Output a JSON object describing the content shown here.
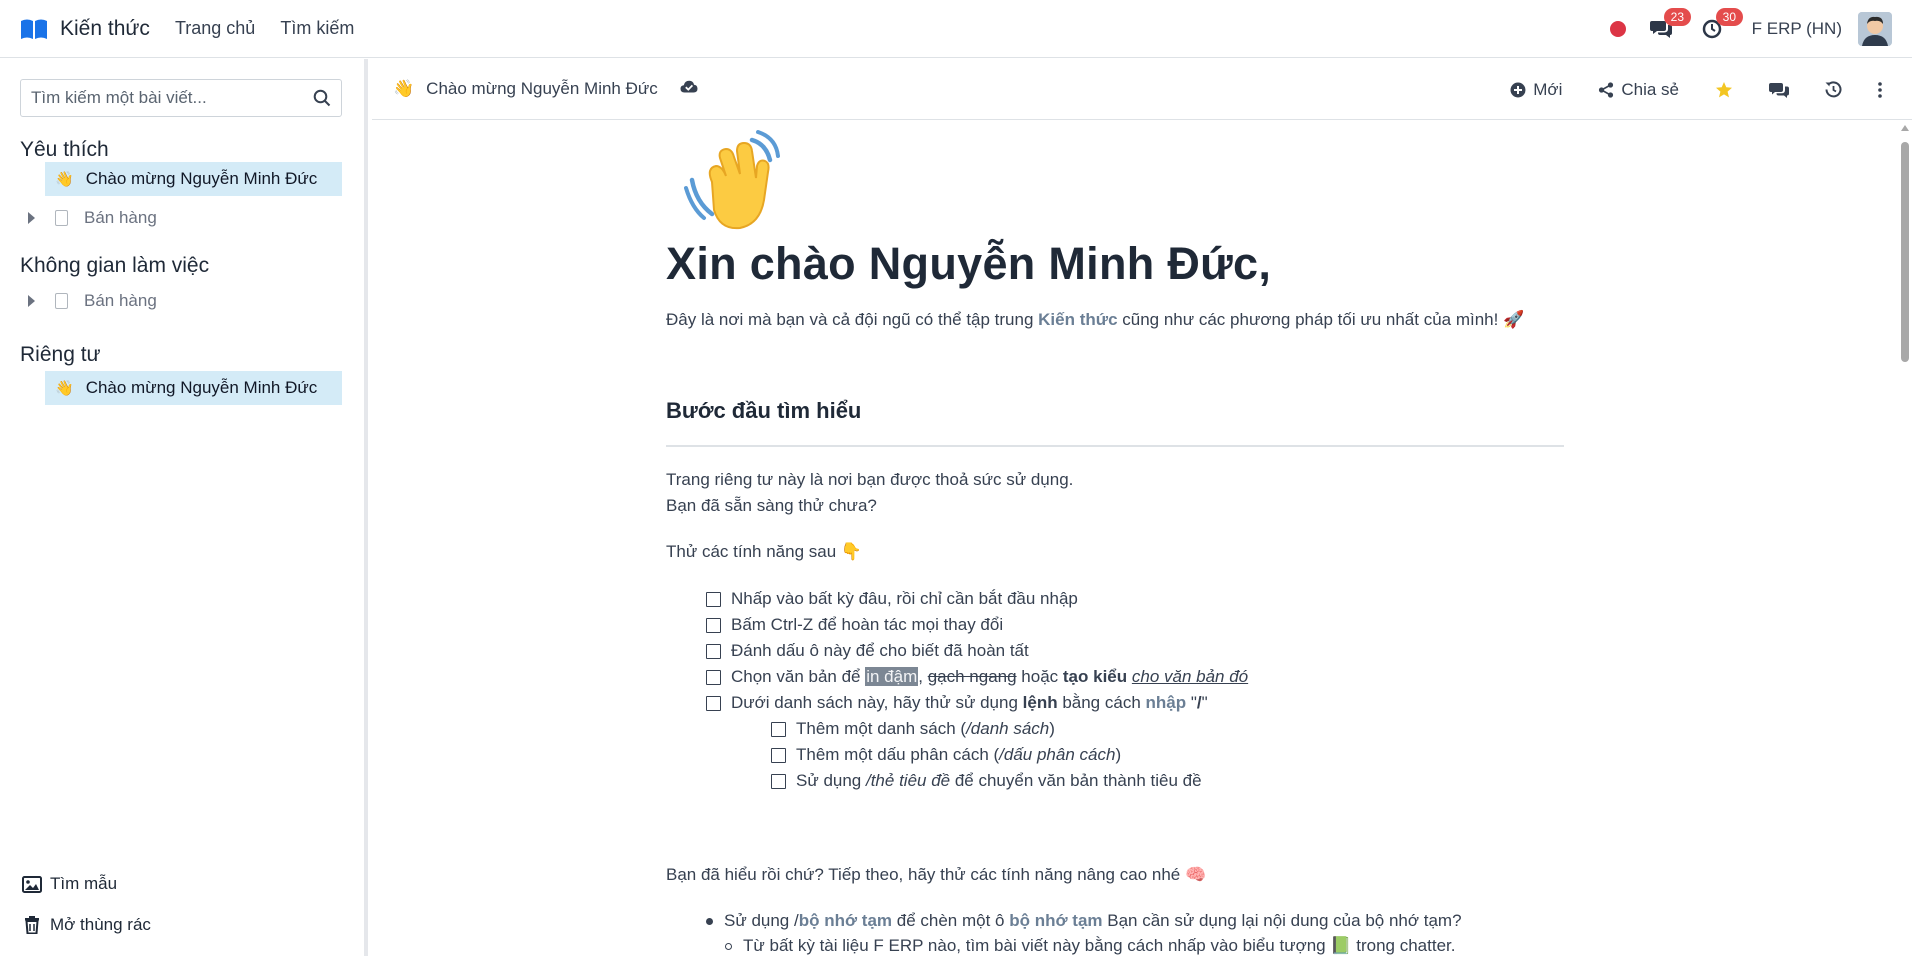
{
  "navbar": {
    "app_title": "Kiến thức",
    "menu": [
      "Trang chủ",
      "Tìm kiếm"
    ],
    "messages_badge": "23",
    "activities_badge": "30",
    "company": "F ERP (HN)"
  },
  "sidebar": {
    "search_placeholder": "Tìm kiếm một bài viết...",
    "favorites_title": "Yêu thích",
    "favorites": [
      {
        "emoji": "👋",
        "label": "Chào mừng Nguyễn Minh Đức",
        "active": true
      },
      {
        "label": "Bán hàng",
        "active": false
      }
    ],
    "workspace_title": "Không gian làm việc",
    "workspace": [
      {
        "label": "Bán hàng"
      }
    ],
    "private_title": "Riêng tư",
    "private": [
      {
        "emoji": "👋",
        "label": "Chào mừng Nguyễn Minh Đức",
        "active": true
      }
    ],
    "templates_label": "Tìm mẫu",
    "trash_label": "Mở thùng rác"
  },
  "header": {
    "emoji": "👋",
    "title": "Chào mừng Nguyễn Minh Đức",
    "new_label": "Mới",
    "share_label": "Chia sẻ"
  },
  "article": {
    "icon": "👋",
    "heading": "Xin chào Nguyễn Minh Đức,",
    "lead_before": "Đây là nơi mà bạn và cả đội ngũ có thể tập trung ",
    "lead_bold": "Kiến thức",
    "lead_after": " cũng như các phương pháp tối ưu nhất của mình! 🚀",
    "section_title": "Bước đầu tìm hiểu",
    "intro_1": "Trang riêng tư này là nơi bạn được thoả sức sử dụng.",
    "intro_2": "Bạn đã sẵn sàng thử chưa?",
    "try_label": "Thử các tính năng sau 👇",
    "todo_1": "Nhấp vào bất kỳ đâu, rồi chỉ cần bắt đầu nhập",
    "todo_2": "Bấm Ctrl-Z để hoàn tác mọi thay đổi",
    "todo_3": "Đánh dấu ô này để cho biết đã hoàn tất",
    "todo_4": {
      "a": "Chọn văn bản để ",
      "b": "in đậm",
      "c": ", ",
      "d": "gạch ngang",
      "e": " hoặc ",
      "f": "tạo kiểu",
      "g": " ",
      "h": "cho văn bản đó"
    },
    "todo_5": {
      "a": "Dưới danh sách này, hãy thử sử dụng ",
      "b": "lệnh",
      "c": " bằng cách ",
      "d": "nhập",
      "e": " \"",
      "f": "/",
      "g": "\""
    },
    "sub_1": {
      "a": "Thêm một danh sách (",
      "b": "/danh sách",
      "c": ")"
    },
    "sub_2": {
      "a": "Thêm một dấu phân cách (",
      "b": "/dấu phân cách",
      "c": ")"
    },
    "sub_3": {
      "a": "Sử dụng ",
      "b": "/thẻ tiêu đề",
      "c": " để chuyển văn bản thành tiêu đề"
    },
    "advanced": "Bạn đã hiểu rồi chứ? Tiếp theo, hãy thử các tính năng nâng cao nhé 🧠",
    "bullet_1": {
      "a": "Sử dụng /",
      "b": "bộ nhớ tạm",
      "c": " để chèn một ô ",
      "d": "bộ nhớ tạm",
      "e": " Bạn cần sử dụng lại nội dung của bộ nhớ tạm?"
    },
    "bullet_1_sub": "Từ bất kỳ tài liệu F ERP nào, tìm bài viết này bằng cách nhấp vào biểu tượng 📗 trong chatter."
  }
}
